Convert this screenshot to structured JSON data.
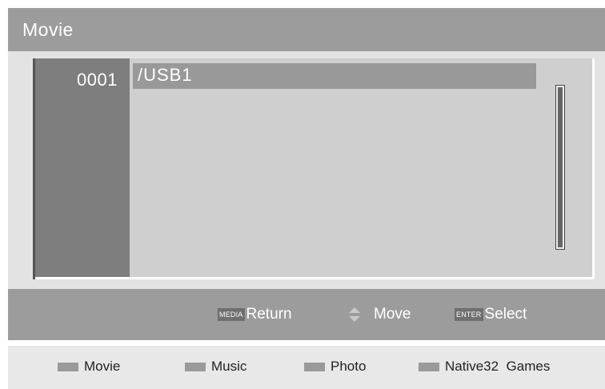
{
  "header": {
    "title": "Movie"
  },
  "browser": {
    "index": "0001",
    "items": [
      {
        "label": "/USB1",
        "selected": true
      }
    ]
  },
  "help": {
    "return": {
      "key": "MEDIA",
      "label": "Return"
    },
    "move": {
      "icon": "up-down-arrows-icon",
      "label": "Move"
    },
    "select": {
      "key": "ENTER",
      "label": "Select"
    }
  },
  "tabs": [
    {
      "label": "Movie"
    },
    {
      "label": "Music"
    },
    {
      "label": "Photo"
    },
    {
      "label": "Native32  Games"
    }
  ],
  "colors": {
    "title_bar": "#9c9c9c",
    "index_column": "#7e7e7e",
    "list_background": "#cfcfcf",
    "selected_row": "#999999"
  }
}
